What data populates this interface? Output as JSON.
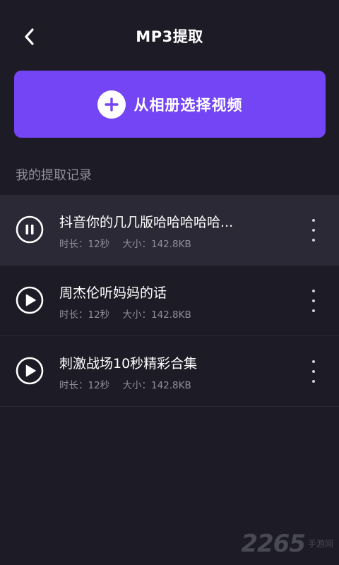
{
  "header": {
    "title": "MP3提取"
  },
  "select_button": {
    "label": "从相册选择视频"
  },
  "section": {
    "title": "我的提取记录"
  },
  "records": [
    {
      "name": "抖音你的几几版哈哈哈哈哈...",
      "duration": "时长：12秒",
      "size": "大小：142.8KB",
      "state": "playing"
    },
    {
      "name": "周杰伦听妈妈的话",
      "duration": "时长：12秒",
      "size": "大小：142.8KB",
      "state": "paused"
    },
    {
      "name": "刺激战场10秒精彩合集",
      "duration": "时长：12秒",
      "size": "大小：142.8KB",
      "state": "paused"
    }
  ],
  "watermark": {
    "number": "2265",
    "text": "手游网"
  },
  "colors": {
    "background": "#1d1c26",
    "accent": "#7445f5",
    "active_row": "#2a2935",
    "secondary_text": "#8f8e99"
  }
}
